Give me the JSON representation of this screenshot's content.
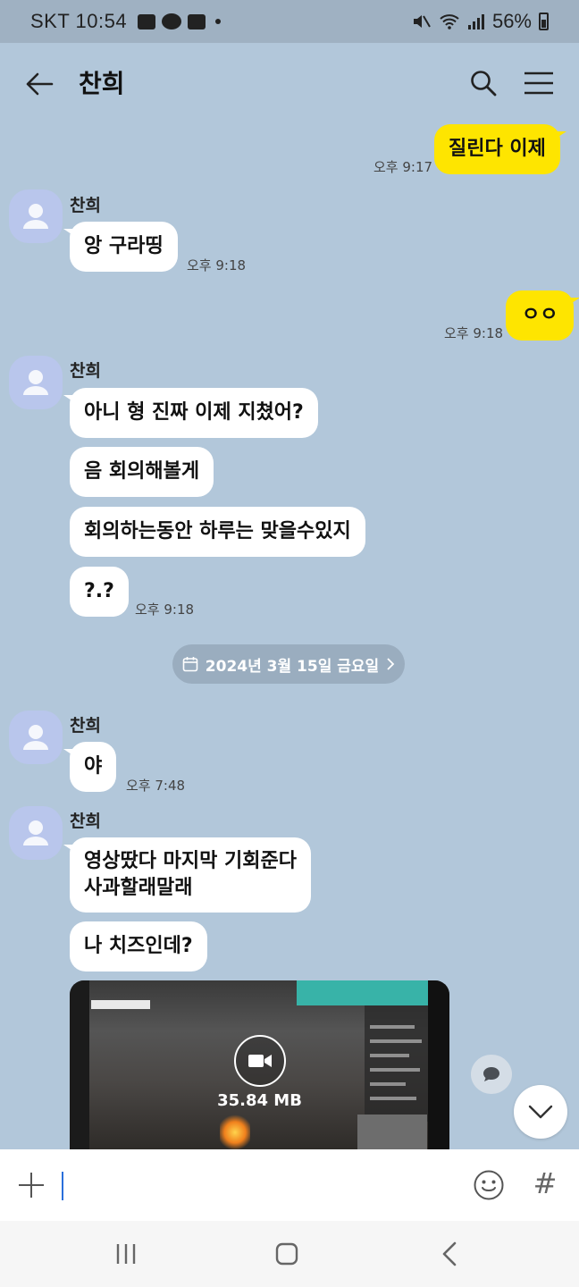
{
  "status_bar": {
    "carrier_time": "SKT 10:54",
    "battery": "56%",
    "icons": [
      "gallery-icon",
      "talk-icon",
      "youtube-icon",
      "dot-icon",
      "mute-icon",
      "wifi-icon",
      "signal-icon",
      "battery-icon"
    ]
  },
  "header": {
    "title": "찬희",
    "icons": [
      "back-arrow-icon",
      "search-icon",
      "menu-icon"
    ]
  },
  "messages": [
    {
      "side": "out",
      "text": "질린다 이제",
      "time": "오후 9:17"
    },
    {
      "side": "in",
      "sender": "찬희",
      "text": "앙 구라띵",
      "time": "오후 9:18"
    },
    {
      "side": "out",
      "text": "ㅇㅇ",
      "time": "오후 9:18"
    },
    {
      "side": "in",
      "sender": "찬희",
      "text": "아니 형 진짜 이제 지쳤어?"
    },
    {
      "side": "in",
      "text": "음 회의해볼게"
    },
    {
      "side": "in",
      "text": "회의하는동안 하루는 맞을수있지"
    },
    {
      "side": "in",
      "text": "?.?",
      "time": "오후 9:18"
    },
    {
      "side": "in",
      "sender": "찬희",
      "text": "야",
      "time": "오후 7:48"
    },
    {
      "side": "in",
      "sender": "찬희",
      "text_lines": [
        "영상땄다 마지막 기회준다",
        "사과할래말래"
      ]
    },
    {
      "side": "in",
      "text": "나 치즈인데?"
    },
    {
      "side": "in",
      "type": "video",
      "size": "35.84 MB"
    }
  ],
  "date_divider": "2024년 3월 15일 금요일",
  "input": {
    "value": "",
    "placeholder": ""
  },
  "input_icons": [
    "plus-icon",
    "emoji-icon",
    "hashtag-icon"
  ],
  "hashtag_glyph": "#",
  "nav_icons": [
    "recents-icon",
    "home-icon",
    "nav-back-icon"
  ],
  "colors": {
    "background": "#b2c7da",
    "my_bubble": "#fee500",
    "their_bubble": "#ffffff",
    "avatar": "#b9c6ec",
    "date_pill": "#9aadbf"
  }
}
